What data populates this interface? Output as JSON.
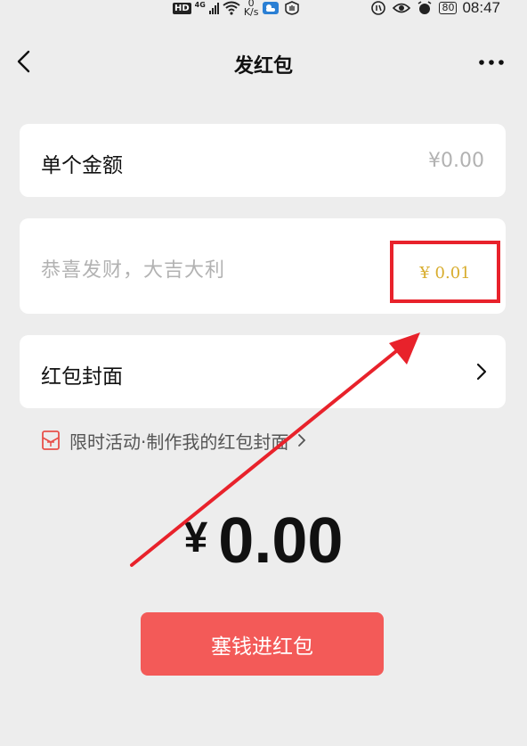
{
  "status_bar": {
    "hd_label": "HD",
    "network_label": "4G",
    "speed_value": "0",
    "speed_unit": "K/s",
    "battery": "80",
    "time": "08:47"
  },
  "header": {
    "title": "发红包",
    "back_icon": "chevron-left-icon",
    "more_icon": "more-dots-icon"
  },
  "amount_card": {
    "label": "单个金额",
    "value": "¥0.00"
  },
  "message_card": {
    "placeholder": "恭喜发财，大吉大利"
  },
  "highlight": {
    "value": "¥ 0.01",
    "box_color": "#e8222b",
    "text_color": "#d8ad2f"
  },
  "cover_card": {
    "label": "红包封面"
  },
  "promo": {
    "text": "限时活动·制作我的红包封面",
    "icon": "red-envelope-icon"
  },
  "total": {
    "currency": "¥",
    "amount": "0.00"
  },
  "primary_button": {
    "label": "塞钱进红包",
    "color": "#f35a58"
  },
  "colors": {
    "background": "#ededed",
    "card": "#ffffff",
    "placeholder": "#b2b2b2",
    "arrow": "#e8222b"
  }
}
